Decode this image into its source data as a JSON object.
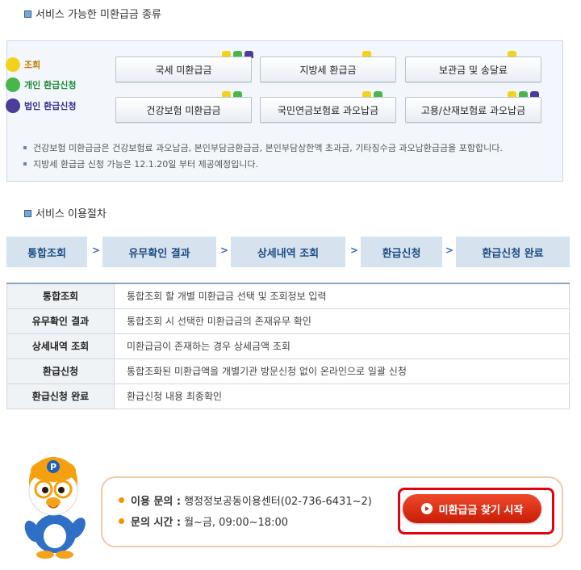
{
  "section1": {
    "title": "서비스 가능한 미환급금 종류",
    "legend": [
      {
        "label": "조회",
        "color": "#f2d31c"
      },
      {
        "label": "개인 환급신청",
        "color": "#48b64a"
      },
      {
        "label": "법인 환급신청",
        "color": "#4c3c9c"
      }
    ],
    "buttons": [
      {
        "label": "국세 미환급금",
        "tabs": [
          "yellow",
          "green",
          "purple"
        ]
      },
      {
        "label": "지방세 환급금",
        "tabs": [
          "yellow"
        ]
      },
      {
        "label": "보관금 및 송달료",
        "tabs": [
          "yellow"
        ]
      },
      {
        "label": "건강보험 미환급금",
        "tabs": [
          "yellow",
          "green"
        ]
      },
      {
        "label": "국민연금보험료 과오납금",
        "tabs": [
          "yellow",
          "green"
        ]
      },
      {
        "label": "고용/산재보험료 과오납금",
        "tabs": [
          "yellow",
          "green",
          "purple"
        ]
      }
    ],
    "notes": [
      "건강보험 미환급금은 건강보험료 과오납금, 본인부담금환급금, 본인부담상한액 초과금, 기타징수금 과오납환급금을 포함합니다.",
      "지방세 환급금 신청 가능은 12.1.20일 부터 제공예정입니다."
    ]
  },
  "section2": {
    "title": "서비스 이용절차",
    "steps": [
      "통합조회",
      "유무확인 결과",
      "상세내역 조회",
      "환급신청",
      "환급신청 완료"
    ],
    "arrow": ">",
    "table": [
      {
        "step": "통합조회",
        "desc": "통합조회 할 개별 미환급금 선택 및 조회정보 입력"
      },
      {
        "step": "유무확인 결과",
        "desc": "통합조회 시 선택한 미환급금의 존재유무 확인"
      },
      {
        "step": "상세내역 조회",
        "desc": "미환급금이 존재하는 경우 상세금액 조회"
      },
      {
        "step": "환급신청",
        "desc": "통합조화된 미환급액을 개별기관 방문신청 없이 온라인으로 일괄 신청"
      },
      {
        "step": "환급신청 완료",
        "desc": "환급신청 내용 최종확인"
      }
    ]
  },
  "contact": {
    "inquiry_label": "이용 문의 :",
    "inquiry_value": "행정정보공동이용센터(02-736-6431~2)",
    "hours_label": "문의 시간 :",
    "hours_value": "월~금, 09:00~18:00",
    "start_button": "미환급금 찾기 시작"
  }
}
